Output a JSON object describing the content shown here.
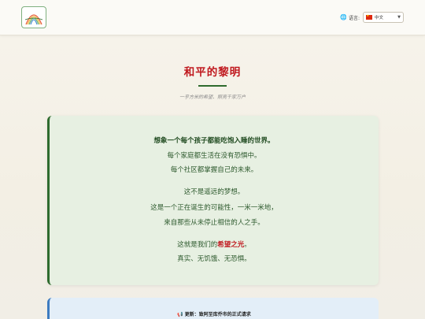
{
  "header": {
    "language_label": "语言:",
    "language_selected": "中文"
  },
  "hero": {
    "title": "和平的黎明",
    "subtitle": "一乎方米的希望、照亮千家万户"
  },
  "message": {
    "line1": "想象一个每个孩子都能吃饱入睡的世界。",
    "line2": "每个家庭都生活在没有恐惧中。",
    "line3": "每个社区都掌握自己的未来。",
    "line4": "这不是遥远的梦想。",
    "line5": "这是一个正在诞生的可能性，一米一米地，",
    "line6": "来自那些从未停止相信的人之手。",
    "line7_prefix": "这就是我们的",
    "line7_highlight": "希望之光",
    "line7_suffix": "。",
    "line8": "真实、无饥饿、无恐惧。"
  },
  "update": {
    "text": "更新：致阿至库乔市的正式请求"
  },
  "colors": {
    "accent_red": "#c0181e",
    "accent_green": "#2e6b2e",
    "card_bg": "#e7f0e2",
    "update_bg": "#e3eef8"
  }
}
